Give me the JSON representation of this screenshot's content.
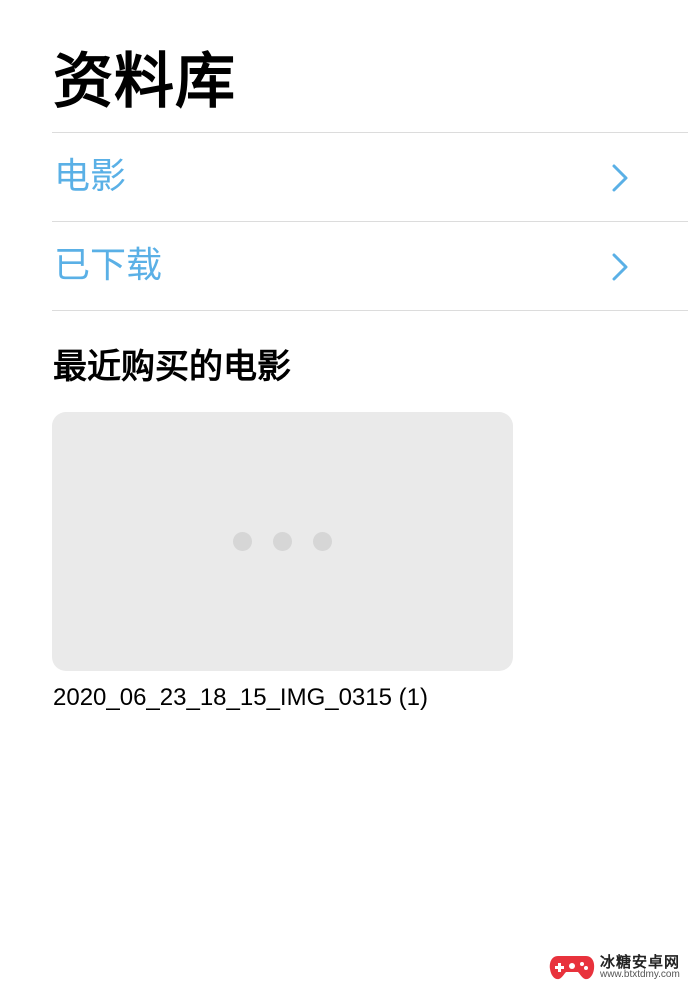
{
  "header": {
    "title": "资料库"
  },
  "list": {
    "items": [
      {
        "label": "电影"
      },
      {
        "label": "已下载"
      }
    ]
  },
  "recent": {
    "section_title": "最近购买的电影",
    "movies": [
      {
        "title": "2020_06_23_18_15_IMG_0315 (1)"
      }
    ]
  },
  "watermark": {
    "name": "冰糖安卓网",
    "url": "www.btxtdmy.com"
  },
  "colors": {
    "accent": "#5ab0e6",
    "divider": "#dcdcdc",
    "thumbnail_bg": "#eaeaea"
  }
}
